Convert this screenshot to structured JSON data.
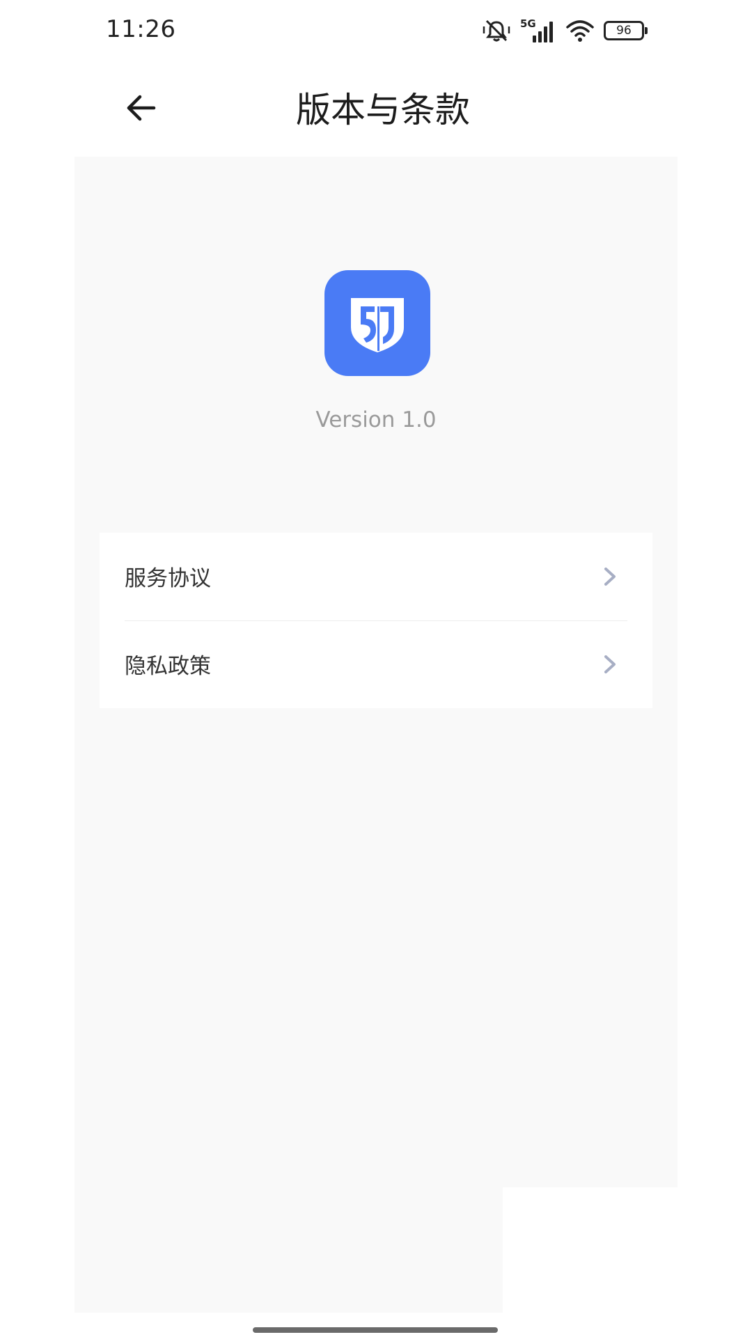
{
  "status_bar": {
    "time": "11:26",
    "network": "5G",
    "battery": "96",
    "icons": [
      "mute-vibrate-icon",
      "cellular-signal-icon",
      "wifi-icon",
      "battery-icon"
    ]
  },
  "header": {
    "title": "版本与条款",
    "back_icon": "arrow-left-icon"
  },
  "app": {
    "icon": "app-shield-logo-icon",
    "brand_color": "#4a7bf5",
    "version": "Version 1.0"
  },
  "menu": {
    "items": [
      {
        "label": "服务协议",
        "icon": "chevron-right-icon"
      },
      {
        "label": "隐私政策",
        "icon": "chevron-right-icon"
      }
    ]
  }
}
